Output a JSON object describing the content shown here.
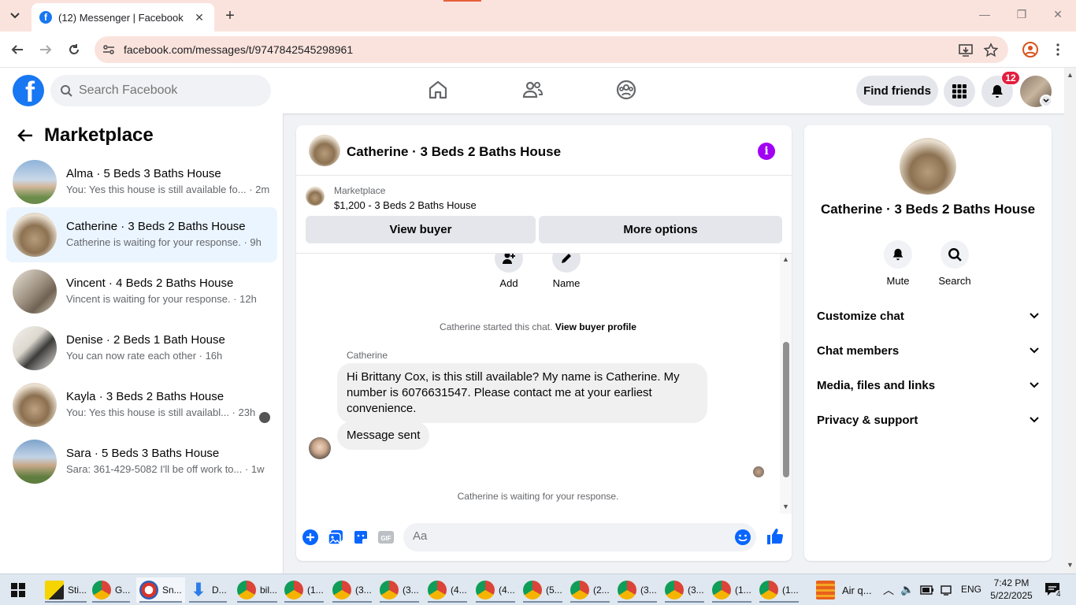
{
  "browser": {
    "tab_title": "(12) Messenger | Facebook",
    "url": "facebook.com/messages/t/9747842545298961"
  },
  "header": {
    "search_placeholder": "Search Facebook",
    "find_friends": "Find friends",
    "notification_count": "12"
  },
  "sidebar": {
    "title": "Marketplace",
    "conversations": [
      {
        "name": "Alma · 5 Beds 3 Baths House",
        "preview": "You: Yes this house is still available fo... · 2m",
        "active": false
      },
      {
        "name": "Catherine · 3 Beds 2 Baths House",
        "preview": "Catherine is waiting for your response. · 9h",
        "active": true
      },
      {
        "name": "Vincent · 4 Beds 2 Baths House",
        "preview": "Vincent is waiting for your response. · 12h",
        "active": false
      },
      {
        "name": "Denise · 2 Beds 1 Bath House",
        "preview": "You can now rate each other · 16h",
        "active": false
      },
      {
        "name": "Kayla · 3 Beds 2 Baths House",
        "preview": "You: Yes this house is still availabl... · 23h",
        "active": false
      },
      {
        "name": "Sara · 5 Beds 3 Baths House",
        "preview": "Sara: 361-429-5082 I'll be off work to... · 1w",
        "active": false
      }
    ]
  },
  "chat": {
    "title": "Catherine · 3 Beds 2 Baths House",
    "listing_label": "Marketplace",
    "listing_value": "$1,200 - 3 Beds 2 Baths House",
    "view_buyer": "View buyer",
    "more_options": "More options",
    "add_label": "Add",
    "name_label": "Name",
    "started_text": "Catherine started this chat.",
    "view_profile": "View buyer profile",
    "sender": "Catherine",
    "message_1": "Hi Brittany Cox, is this still available?  My name is Catherine.  My number is 6076631547.  Please contact me at your earliest convenience.",
    "message_2": "Message sent",
    "waiting": "Catherine is waiting for your response.",
    "composer_placeholder": "Aa"
  },
  "info_pane": {
    "title": "Catherine · 3 Beds 2 Baths House",
    "mute": "Mute",
    "search": "Search",
    "sections": [
      "Customize chat",
      "Chat members",
      "Media, files and links",
      "Privacy & support"
    ]
  },
  "taskbar": {
    "items": [
      "Sti...",
      "G...",
      "Sn...",
      "D...",
      "bil...",
      "(1...",
      "(3...",
      "(3...",
      "(4...",
      "(4...",
      "(5...",
      "(2...",
      "(3...",
      "(3...",
      "(1...",
      "(1..."
    ],
    "weather": "Air q...",
    "lang": "ENG",
    "time": "7:42 PM",
    "date": "5/22/2025",
    "notif_count": "4"
  }
}
